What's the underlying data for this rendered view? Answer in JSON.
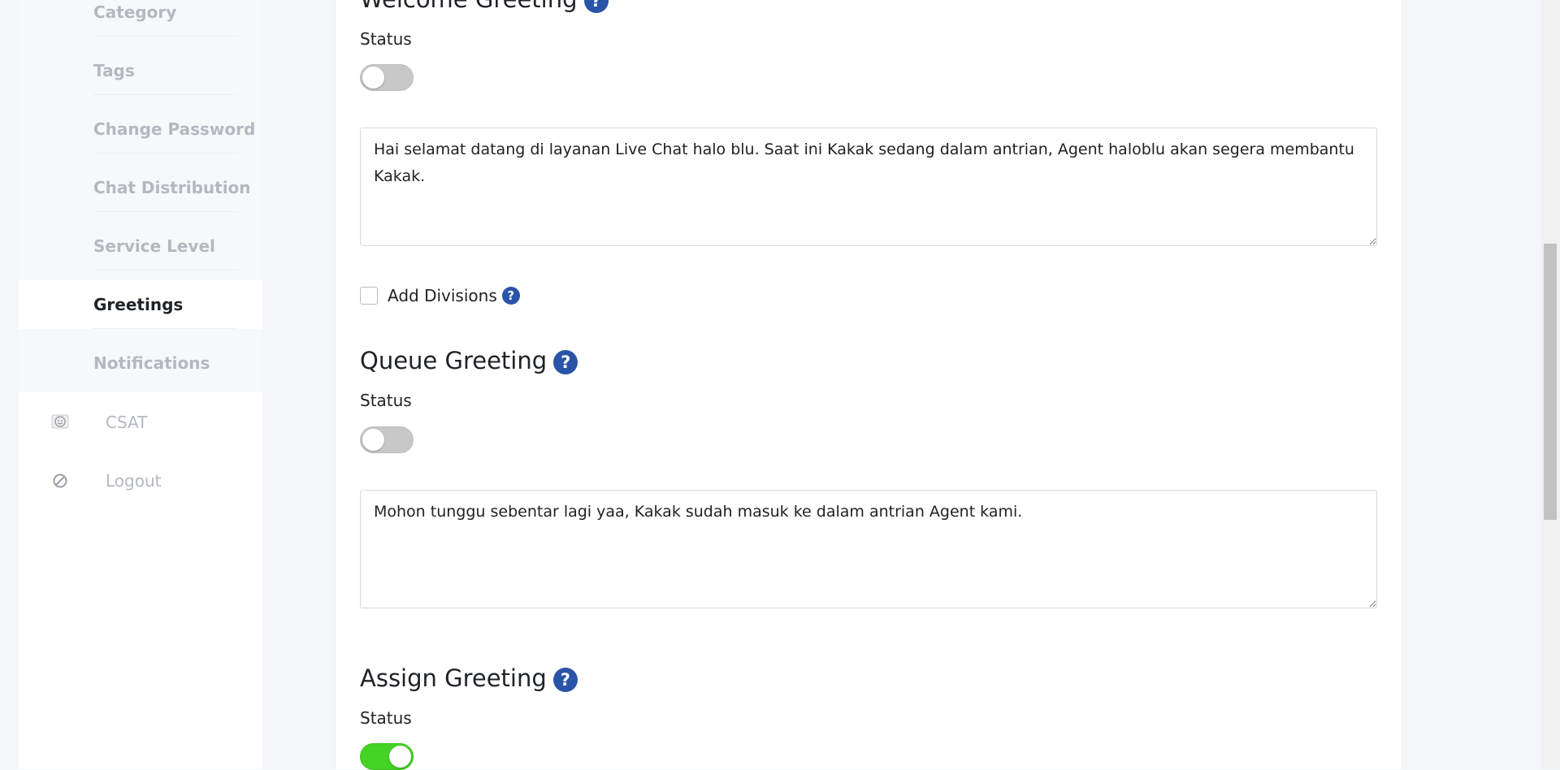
{
  "sidebar": {
    "sub_items": [
      {
        "label": "Category"
      },
      {
        "label": "Tags"
      },
      {
        "label": "Change Password"
      },
      {
        "label": "Chat Distribution"
      },
      {
        "label": "Service Level"
      },
      {
        "label": "Greetings",
        "active": true
      },
      {
        "label": "Notifications"
      }
    ],
    "main_items": [
      {
        "label": "CSAT",
        "icon": "smiley-icon"
      },
      {
        "label": "Logout",
        "icon": "logout-icon"
      }
    ]
  },
  "welcome": {
    "title": "Welcome Greeting",
    "status_label": "Status",
    "enabled": false,
    "message": "Hai selamat datang di layanan Live Chat halo blu. Saat ini Kakak sedang dalam antrian, Agent haloblu akan segera membantu Kakak."
  },
  "add_divisions": {
    "label": "Add Divisions",
    "checked": false
  },
  "queue": {
    "title": "Queue Greeting",
    "status_label": "Status",
    "enabled": false,
    "message": "Mohon tunggu sebentar lagi yaa, Kakak sudah masuk ke dalam antrian Agent kami."
  },
  "assign": {
    "title": "Assign Greeting",
    "status_label": "Status",
    "enabled": true
  },
  "help_glyph": "?"
}
